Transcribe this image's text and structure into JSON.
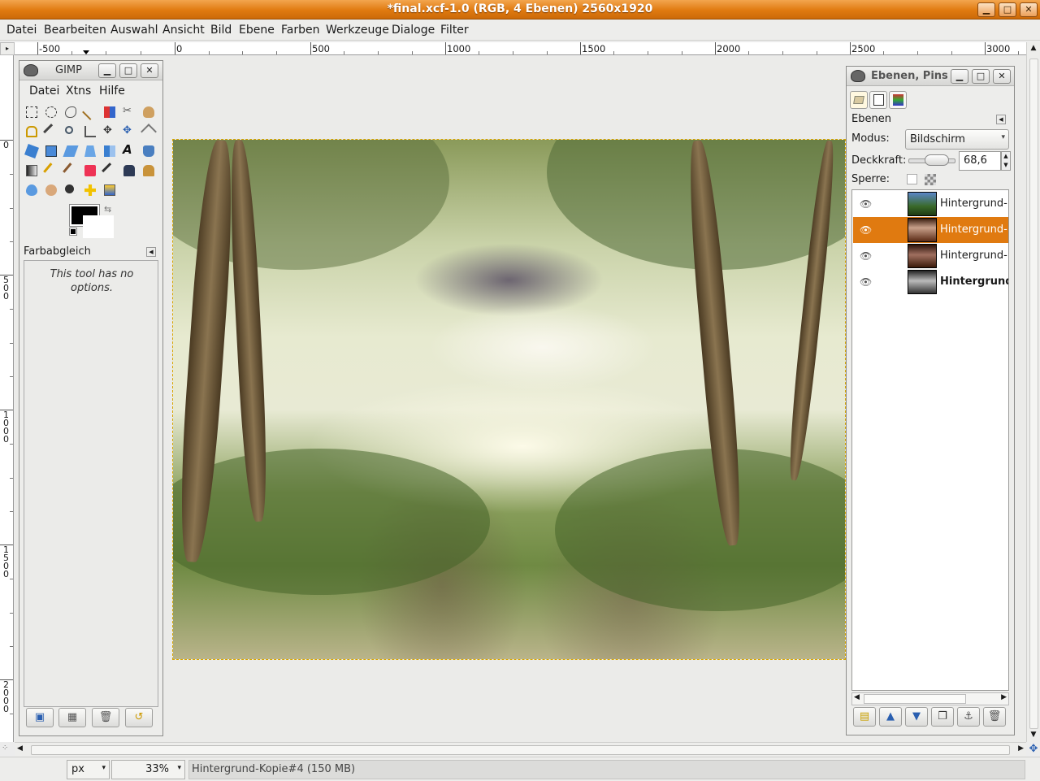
{
  "window": {
    "title": "*final.xcf-1.0 (RGB, 4 Ebenen) 2560x1920",
    "minimize": "▁",
    "maximize": "□",
    "close": "✕"
  },
  "menubar": [
    "Datei",
    "Bearbeiten",
    "Auswahl",
    "Ansicht",
    "Bild",
    "Ebene",
    "Farben",
    "Werkzeuge",
    "Dialoge",
    "Filter"
  ],
  "ruler": {
    "h_labels": [
      "-500",
      "0",
      "500",
      "1000",
      "1500",
      "2000",
      "2500",
      "3000"
    ],
    "v_labels": [
      "0",
      "500",
      "1000",
      "1500",
      "2000"
    ]
  },
  "toolbox": {
    "title": "GIMP",
    "menu": [
      "Datei",
      "Xtns",
      "Hilfe"
    ],
    "tool_options_title": "Farbabgleich",
    "tool_options_message": "This tool has no options.",
    "foreground_color": "#000000",
    "background_color": "#ffffff"
  },
  "layers": {
    "title": "Ebenen, Pins",
    "section": "Ebenen",
    "mode_label": "Modus:",
    "mode_value": "Bildschirm",
    "opacity_label": "Deckkraft:",
    "opacity_value": "68,6",
    "opacity_fraction": 0.686,
    "lock_label": "Sperre:",
    "items": [
      {
        "name": "Hintergrund-K",
        "selected": false,
        "bold": false
      },
      {
        "name": "Hintergrund-K",
        "selected": true,
        "bold": false
      },
      {
        "name": "Hintergrund-K",
        "selected": false,
        "bold": false
      },
      {
        "name": "Hintergrund",
        "selected": false,
        "bold": true
      }
    ]
  },
  "statusbar": {
    "unit": "px",
    "zoom": "33%",
    "message": "Hintergrund-Kopie#4 (150 MB)"
  },
  "colors": {
    "accent": "#e07a10",
    "titlebar": "#e07a10"
  }
}
